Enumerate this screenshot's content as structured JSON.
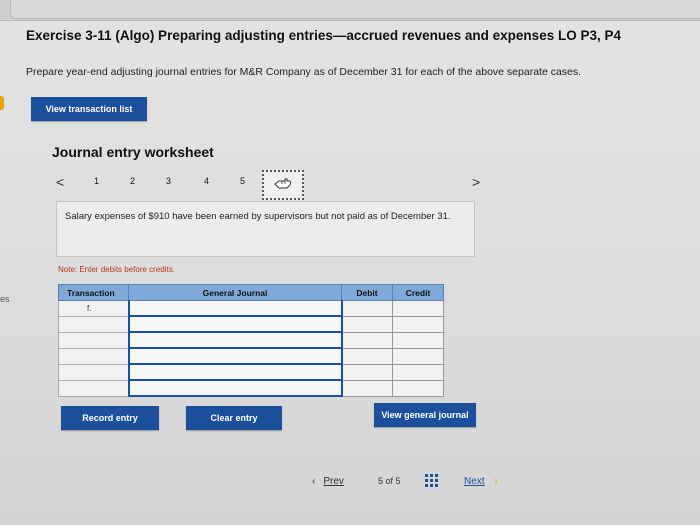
{
  "header": {
    "title": "Exercise 3-11 (Algo) Preparing adjusting entries—accrued revenues and expenses LO P3, P4",
    "subtitle": "Prepare year-end adjusting journal entries for M&R Company as of December 31 for each of the above separate cases."
  },
  "buttons": {
    "view_transaction_list": "View transaction list",
    "record_entry": "Record entry",
    "clear_entry": "Clear entry",
    "view_general_journal": "View general journal"
  },
  "worksheet": {
    "title": "Journal entry worksheet",
    "pages": [
      "1",
      "2",
      "3",
      "4",
      "5"
    ],
    "prev_arrow": "<",
    "next_arrow": ">",
    "prompt": "Salary expenses of $910 have been earned by supervisors but not paid as of December 31.",
    "note": "Note: Enter debits before credits."
  },
  "journal": {
    "headers": {
      "transaction": "Transaction",
      "general_journal": "General Journal",
      "debit": "Debit",
      "credit": "Credit"
    },
    "rows": [
      {
        "transaction": "f.",
        "account": "",
        "debit": "",
        "credit": ""
      },
      {
        "transaction": "",
        "account": "",
        "debit": "",
        "credit": ""
      },
      {
        "transaction": "",
        "account": "",
        "debit": "",
        "credit": ""
      },
      {
        "transaction": "",
        "account": "",
        "debit": "",
        "credit": ""
      },
      {
        "transaction": "",
        "account": "",
        "debit": "",
        "credit": ""
      },
      {
        "transaction": "",
        "account": "",
        "debit": "",
        "credit": ""
      }
    ]
  },
  "footer": {
    "prev_label": "Prev",
    "page_count": "5 of 5",
    "next_label": "Next"
  },
  "edge_text": "es",
  "colors": {
    "primary_blue": "#1c4f9c",
    "table_header": "#7fa8d8",
    "note_red": "#b23a1a",
    "accent_orange": "#e5a400"
  }
}
